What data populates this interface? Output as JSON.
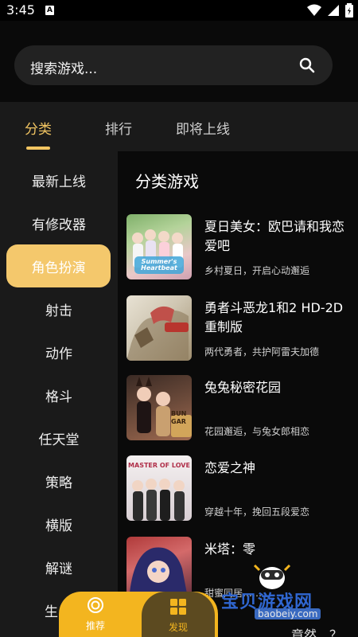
{
  "status_bar": {
    "time": "3:45",
    "notification_letter": "A"
  },
  "search": {
    "placeholder": "搜索游戏..."
  },
  "tabs": [
    {
      "label": "分类",
      "active": true
    },
    {
      "label": "排行",
      "active": false
    },
    {
      "label": "即将上线",
      "active": false
    }
  ],
  "sidebar": {
    "items": [
      {
        "label": "最新上线"
      },
      {
        "label": "有修改器"
      },
      {
        "label": "角色扮演",
        "active": true
      },
      {
        "label": "射击"
      },
      {
        "label": "动作"
      },
      {
        "label": "格斗"
      },
      {
        "label": "任天堂"
      },
      {
        "label": "策略"
      },
      {
        "label": "横版"
      },
      {
        "label": "解谜"
      },
      {
        "label": "生"
      }
    ]
  },
  "main": {
    "title": "分类游戏",
    "games": [
      {
        "title": "夏日美女：欧巴请和我恋爱吧",
        "desc": "乡村夏日，开启心动邂逅",
        "thumb_text": "Summer's Heartbeat"
      },
      {
        "title": "勇者斗恶龙1和2 HD-2D重制版",
        "desc": "两代勇者，共护阿雷夫加德",
        "thumb_text": ""
      },
      {
        "title": "兔兔秘密花园",
        "desc": "花园邂逅，与兔女郎相恋",
        "thumb_text": "BUN GAR"
      },
      {
        "title": "恋爱之神",
        "desc": "穿越十年，挽回五段爱恋",
        "thumb_text": "MASTER OF LOVE"
      },
      {
        "title": "米塔：零",
        "desc": "甜蜜同居……",
        "thumb_text": ""
      }
    ],
    "partial_text": "竟然…？"
  },
  "bottom_nav": {
    "items": [
      {
        "label": "推荐",
        "icon": "target-icon"
      },
      {
        "label": "发现",
        "icon": "grid-icon"
      }
    ]
  },
  "watermark": {
    "main": "宝贝游戏网",
    "sub": "baobeiy.com"
  },
  "colors": {
    "accent": "#f2c562",
    "sidebar_active": "#f4c86c",
    "nav_bg": "#f3b51f"
  }
}
